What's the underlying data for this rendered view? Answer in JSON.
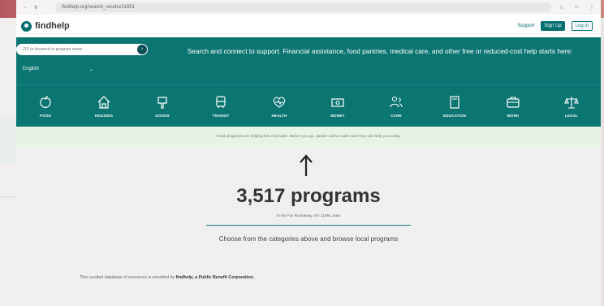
{
  "browser": {
    "url": "findhelp.org/search_results/11691"
  },
  "brand": {
    "name": "findhelp"
  },
  "nav": {
    "support": "Support",
    "signup": "Sign Up",
    "login": "Log in"
  },
  "search": {
    "placeholder": "ZIP or keyword or program name",
    "language": "English"
  },
  "hero": {
    "text": "Search and connect to support. Financial assistance, food pantries, medical care, and other free or reduced-cost help starts here:"
  },
  "categories": [
    {
      "label": "FOOD",
      "icon": "apple-icon"
    },
    {
      "label": "HOUSING",
      "icon": "house-icon"
    },
    {
      "label": "GOODS",
      "icon": "hanger-icon"
    },
    {
      "label": "TRANSIT",
      "icon": "bus-icon"
    },
    {
      "label": "HEALTH",
      "icon": "heart-pulse-icon"
    },
    {
      "label": "MONEY",
      "icon": "money-icon"
    },
    {
      "label": "CARE",
      "icon": "people-icon"
    },
    {
      "label": "EDUCATION",
      "icon": "book-icon"
    },
    {
      "label": "WORK",
      "icon": "briefcase-icon"
    },
    {
      "label": "LEGAL",
      "icon": "scales-icon"
    }
  ],
  "notice": "Food programs are helping lots of people. Before you go, please call to make sure they can help you today.",
  "results": {
    "count": "3,517 programs",
    "location": "in the Far Rockaway, NY 11691 area",
    "hint": "Choose from the categories above and browse local programs"
  },
  "footer": {
    "prefix": "This curated database of resources is provided by ",
    "provider": "findhelp, a Public Benefit Corporation."
  },
  "colors": {
    "brand": "#0b7572",
    "notice_bg": "#e7f3e7"
  }
}
